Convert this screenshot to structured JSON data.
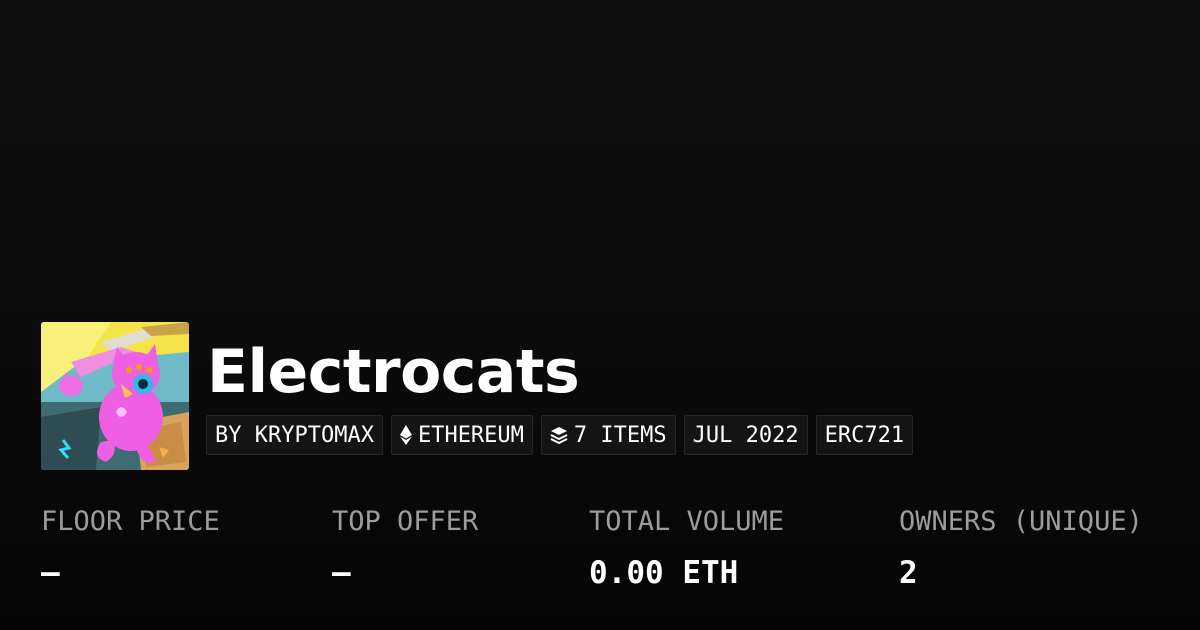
{
  "collection": {
    "name": "Electrocats",
    "avatar_icon": "electrocat-artwork-icon"
  },
  "chips": {
    "creator": "BY KRYPTOMAX",
    "chain": "ETHEREUM",
    "chain_icon": "ethereum-icon",
    "items": "7 ITEMS",
    "items_icon": "layers-icon",
    "date": "JUL 2022",
    "standard": "ERC721"
  },
  "stats": {
    "floor_price": {
      "label": "FLOOR PRICE",
      "value": "–"
    },
    "top_offer": {
      "label": "TOP OFFER",
      "value": "–"
    },
    "total_volume": {
      "label": "TOTAL VOLUME",
      "value": "0.00 ETH"
    },
    "owners": {
      "label": "OWNERS (UNIQUE)",
      "value": "2"
    }
  },
  "colors": {
    "background": "#0b0b0b",
    "chip_background": "#141414",
    "label_gray": "#9c9c9c",
    "text": "#ffffff"
  }
}
